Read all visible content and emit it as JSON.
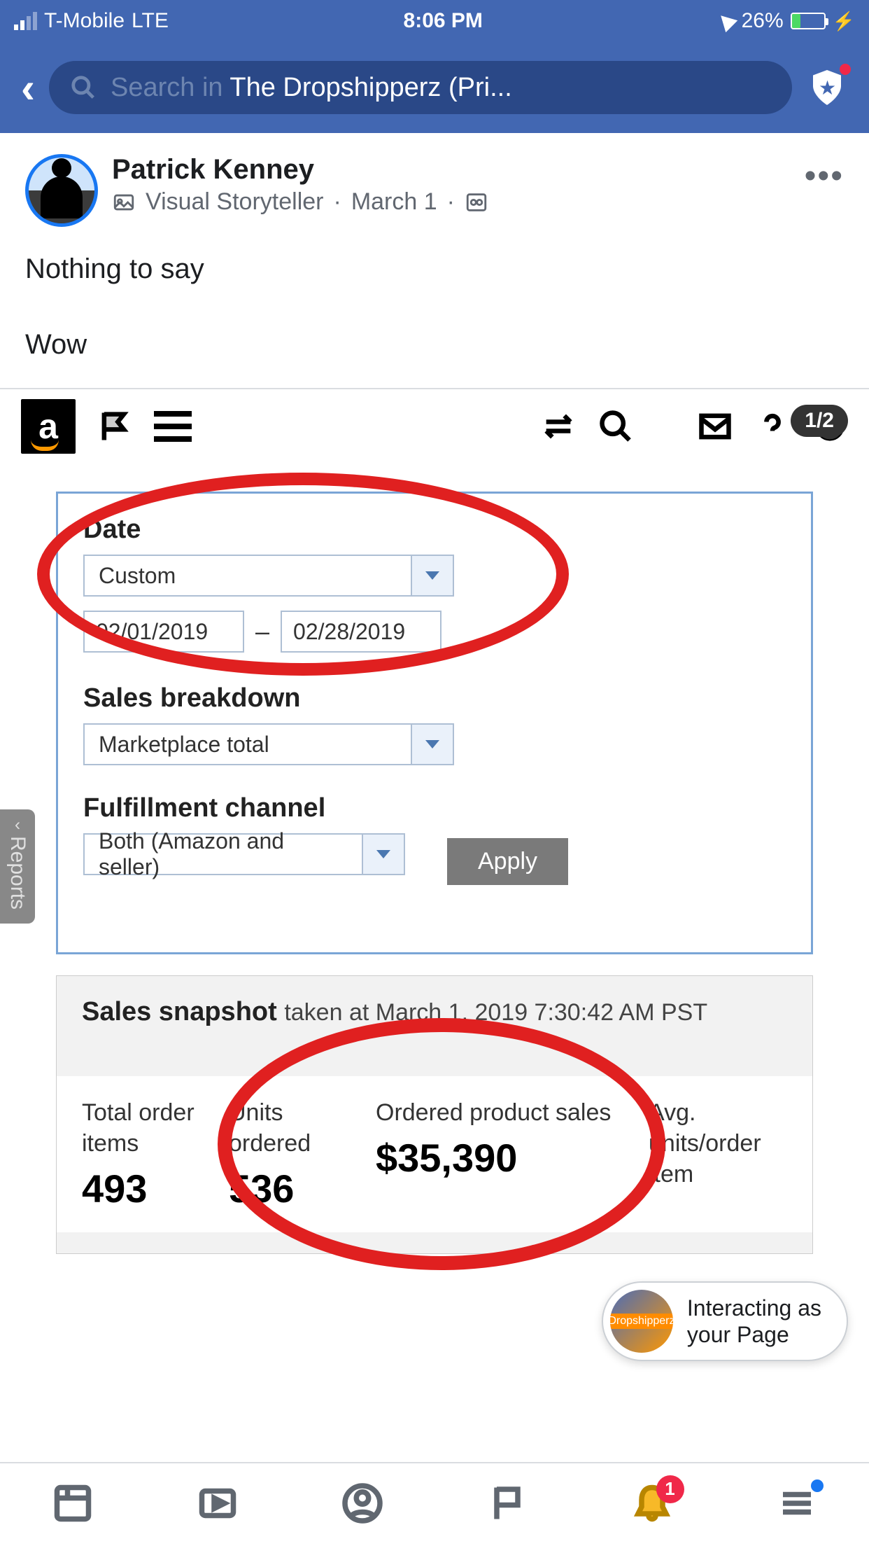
{
  "status": {
    "carrier": "T-Mobile",
    "network": "LTE",
    "time": "8:06 PM",
    "battery_pct": "26%"
  },
  "header": {
    "search_prefix": "Search in ",
    "search_group": "The Dropshipperz (Pri..."
  },
  "post": {
    "author": "Patrick Kenney",
    "badge": "Visual Storyteller",
    "date": "March 1",
    "body1": "Nothing to say",
    "body2": "Wow"
  },
  "amazon": {
    "page_indicator": "1/2",
    "filters": {
      "date_label": "Date",
      "date_range_sel": "Custom",
      "date_from": "02/01/2019",
      "date_to": "02/28/2019",
      "breakdown_label": "Sales breakdown",
      "breakdown_sel": "Marketplace total",
      "channel_label": "Fulfillment channel",
      "channel_sel": "Both (Amazon and seller)",
      "apply": "Apply"
    },
    "reports_tab": "Reports",
    "snapshot": {
      "title": "Sales snapshot",
      "taken": "taken at March 1, 2019 7:30:42 AM PST",
      "metrics": {
        "m1_label": "Total order items",
        "m1_val": "493",
        "m2_label": "Units ordered",
        "m2_val": "536",
        "m3_label": "Ordered product sales",
        "m3_val": "$35,390",
        "m4_label": "Avg. units/order item"
      }
    }
  },
  "interact": {
    "line1": "Interacting as",
    "line2": "your Page",
    "pic_label": "Dropshipperz"
  },
  "tabs": {
    "notif_count": "1"
  }
}
